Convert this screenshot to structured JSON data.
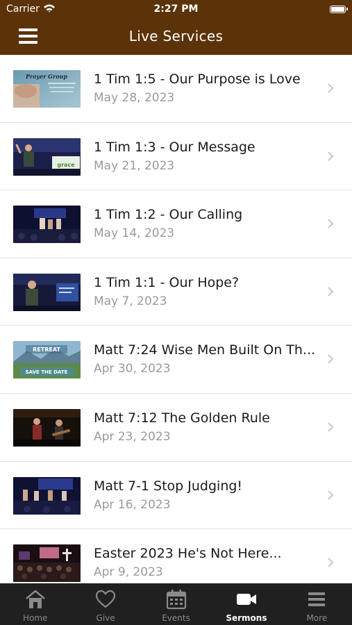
{
  "status": {
    "carrier": "Carrier",
    "time": "2:27 PM"
  },
  "header": {
    "title": "Live Services"
  },
  "sermons": [
    {
      "title": "1 Tim 1:5 - Our Purpose is Love",
      "date": "May 28, 2023",
      "thumb_text": "Prayer Group"
    },
    {
      "title": "1 Tim 1:3 - Our Message",
      "date": "May 21, 2023"
    },
    {
      "title": "1 Tim 1:2 - Our Calling",
      "date": "May 14, 2023"
    },
    {
      "title": "1 Tim 1:1 - Our Hope?",
      "date": "May 7, 2023"
    },
    {
      "title": "Matt 7:24 Wise Men Built On Th...",
      "date": "Apr 30, 2023",
      "thumb_text": "RETREAT",
      "thumb_text2": "SAVE THE DATE"
    },
    {
      "title": "Matt 7:12 The Golden Rule",
      "date": "Apr 23, 2023"
    },
    {
      "title": "Matt 7-1 Stop Judging!",
      "date": "Apr 16, 2023"
    },
    {
      "title": "Easter 2023 He's Not Here...",
      "date": "Apr 9, 2023"
    }
  ],
  "tabs": [
    {
      "label": "Home",
      "icon": "home-icon"
    },
    {
      "label": "Give",
      "icon": "heart-icon"
    },
    {
      "label": "Events",
      "icon": "calendar-icon"
    },
    {
      "label": "Sermons",
      "icon": "video-camera-icon",
      "active": true
    },
    {
      "label": "More",
      "icon": "menu-icon"
    }
  ],
  "colors": {
    "header": "#5c3209",
    "tabbar": "#202020",
    "active_tab": "#ffffff",
    "inactive_tab": "#8a8a8a"
  }
}
